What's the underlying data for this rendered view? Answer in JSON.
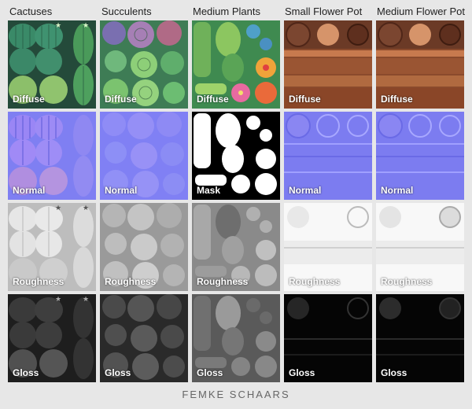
{
  "columns": [
    "Cactuses",
    "Succulents",
    "Medium Plants",
    "Small Flower Pot",
    "Medium Flower Pot"
  ],
  "rows": [
    "Diffuse",
    "Normal",
    "Roughness",
    "Gloss"
  ],
  "mask_label": "Mask",
  "credit": "FEMKE SCHAARS",
  "colors": {
    "page_bg": "#e7e7e7",
    "diffuse_cactus": "#2f6b50",
    "diffuse_succulent": "#5fa86a",
    "diffuse_plants": "#4d9a56",
    "diffuse_pot": "#7a3d23",
    "normal": "#8080ff",
    "roughness": "#dcdcdc",
    "gloss": "#1c1c1c"
  }
}
